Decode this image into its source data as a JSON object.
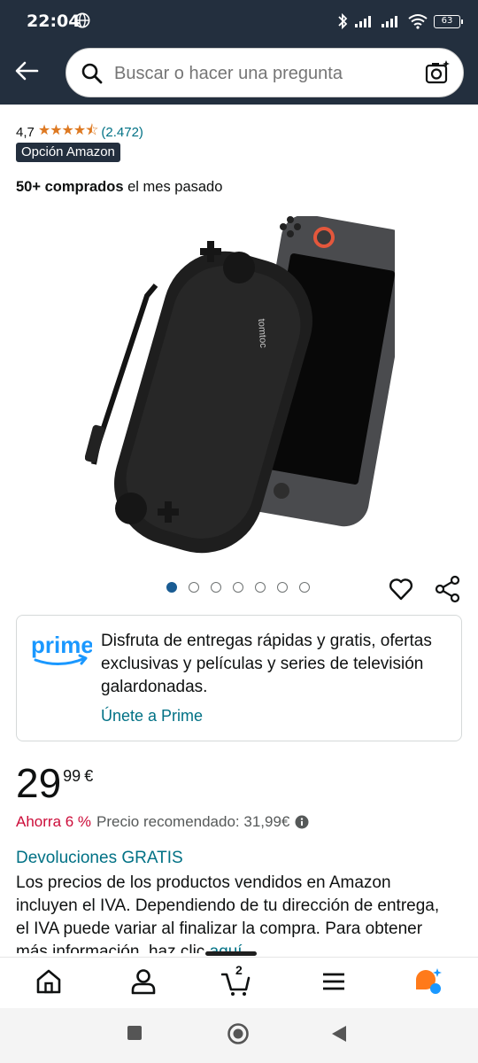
{
  "status_bar": {
    "time": "22:04",
    "battery": "63",
    "icons": [
      "globe-icon",
      "bluetooth-icon",
      "signal-icon",
      "signal-icon",
      "wifi-icon",
      "battery-icon"
    ]
  },
  "header": {
    "search_placeholder": "Buscar o hacer una pregunta",
    "icons": [
      "back-arrow-icon",
      "search-icon",
      "camera-search-icon"
    ]
  },
  "product": {
    "rating": "4,7",
    "stars": "★★★★⯪",
    "rating_count": "(2.472)",
    "badge": "Opción Amazon",
    "bought_bold": "50+ comprados",
    "bought_rest": " el mes pasado",
    "image_brand_text": "tomtoc",
    "carousel": {
      "total": 7,
      "active": 1
    }
  },
  "prime": {
    "logo_text": "prime",
    "message": "Disfruta de entregas rápidas y gratis, ofertas exclusivas y películas y series de televisión galardonadas.",
    "link": "Únete a Prime"
  },
  "price": {
    "whole": "29",
    "fraction": "99",
    "currency": "€",
    "savings": "Ahorra 6 %",
    "reference": "Precio recomendado: 31,99€"
  },
  "returns": {
    "label": "Devoluciones GRATIS",
    "vat_text": "Los precios de los productos vendidos en Amazon incluyen el IVA. Dependiendo de tu dirección de entrega, el IVA puede variar al finalizar la compra. Para obtener más información, haz clic ",
    "vat_link": "aquí"
  },
  "bottom_nav": {
    "items": [
      "home-icon",
      "account-icon",
      "cart-icon",
      "menu-icon",
      "rufus-icon"
    ],
    "cart_count": "2"
  },
  "colors": {
    "header_bg": "#232f3e",
    "link": "#007185",
    "star": "#de7921",
    "savings": "#cc0c39",
    "prime_blue": "#1a98ff"
  }
}
